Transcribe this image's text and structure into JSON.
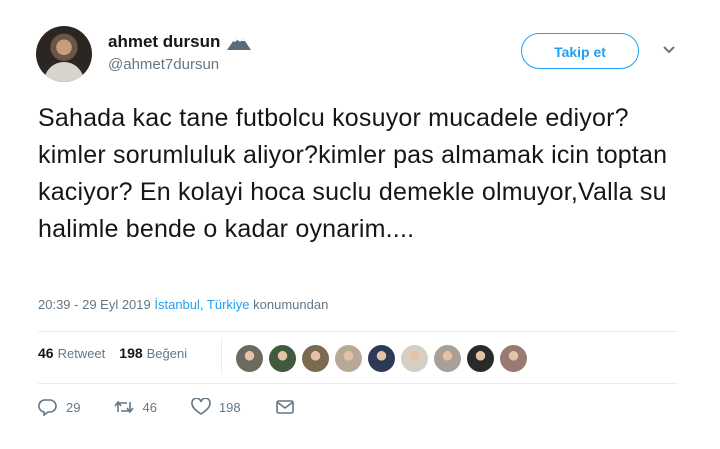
{
  "user": {
    "name": "ahmet dursun",
    "handle": "@ahmet7dursun"
  },
  "follow_label": "Takip et",
  "tweet_text": "Sahada kac tane futbolcu kosuyor mucadele ediyor?kimler sorumluluk aliyor?kimler pas almamak icin toptan kaciyor? En kolayi hoca suclu demekle olmuyor,Valla su halimle bende o kadar oynarim....",
  "meta": {
    "time": "20:39 - 29 Eyl 2019",
    "location": "İstanbul, Türkiye",
    "location_suffix": "konumundan"
  },
  "stats": {
    "retweets": "46",
    "retweets_label": "Retweet",
    "likes": "198",
    "likes_label": "Beğeni"
  },
  "liker_avatar_colors": [
    "#6b6a5e",
    "#3f5a3c",
    "#7a6a50",
    "#b8a896",
    "#2c3a55",
    "#d8cfc4",
    "#a8a094",
    "#2a2a2a",
    "#9a7a70"
  ],
  "actions": {
    "replies": "29",
    "retweets": "46",
    "likes": "198"
  },
  "icons": [
    "reply-icon",
    "retweet-icon",
    "like-icon",
    "direct-message-icon",
    "chevron-down-icon"
  ],
  "colors": {
    "accent": "#1da1f2",
    "secondary_text": "#657786",
    "primary_text": "#14171a"
  }
}
